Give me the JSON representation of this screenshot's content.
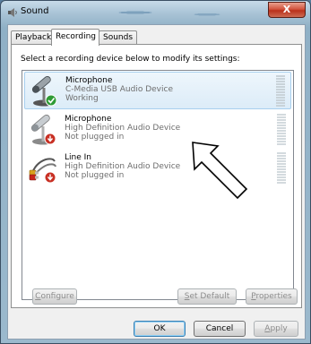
{
  "window": {
    "title": "Sound",
    "close_glyph": "X"
  },
  "tabs": [
    {
      "label": "Playback",
      "active": false
    },
    {
      "label": "Recording",
      "active": true
    },
    {
      "label": "Sounds",
      "active": false
    }
  ],
  "instructions": "Select a recording device below to modify its settings:",
  "devices": [
    {
      "name": "Microphone",
      "description": "C-Media USB Audio Device",
      "status": "Working",
      "icon": "microphone-icon",
      "badge": "green-check-badge-icon",
      "selected": true
    },
    {
      "name": "Microphone",
      "description": "High Definition Audio Device",
      "status": "Not plugged in",
      "icon": "microphone-icon",
      "badge": "red-down-arrow-badge-icon",
      "selected": false
    },
    {
      "name": "Line In",
      "description": "High Definition Audio Device",
      "status": "Not plugged in",
      "icon": "line-in-cable-icon",
      "badge": "red-down-arrow-badge-icon",
      "selected": false
    }
  ],
  "buttons": {
    "configure": {
      "pre": "",
      "accel": "C",
      "post": "onfigure"
    },
    "set_default": {
      "pre": "",
      "accel": "S",
      "post": "et Default"
    },
    "properties": {
      "pre": "",
      "accel": "P",
      "post": "roperties"
    },
    "ok": "OK",
    "cancel": "Cancel",
    "apply": {
      "pre": "",
      "accel": "A",
      "post": "pply"
    }
  },
  "colors": {
    "selection_border": "#a7cfee",
    "status_text": "#6d6d6d",
    "close_button": "#c9452f"
  }
}
